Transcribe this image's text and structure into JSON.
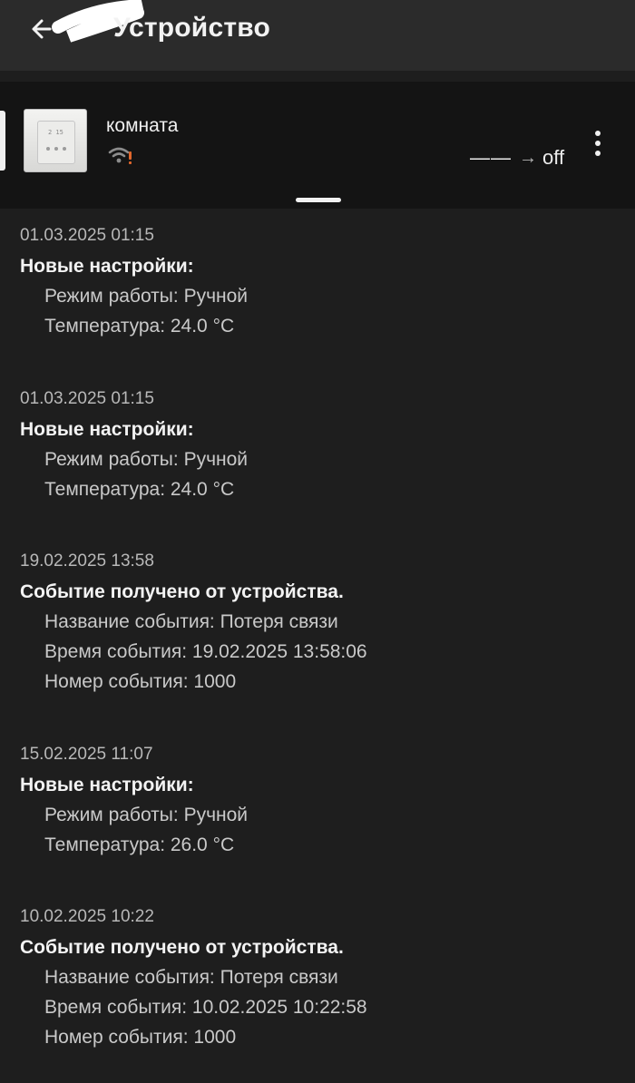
{
  "header": {
    "title": "Устройство"
  },
  "device": {
    "name": "комната",
    "status_dashes": "——",
    "status_arrow": "→",
    "status_value": "off",
    "wifi_icon": "wifi-warning-icon",
    "thumbnail_display": "2 15"
  },
  "events": [
    {
      "timestamp": "01.03.2025 01:15",
      "heading": "Новые настройки:",
      "details": [
        "Режим работы: Ручной",
        "Температура: 24.0 °C"
      ]
    },
    {
      "timestamp": "01.03.2025 01:15",
      "heading": "Новые настройки:",
      "details": [
        "Режим работы: Ручной",
        "Температура: 24.0 °C"
      ]
    },
    {
      "timestamp": "19.02.2025 13:58",
      "heading": "Событие получено от устройства.",
      "details": [
        "Название события: Потеря связи",
        "Время события: 19.02.2025 13:58:06",
        "Номер события: 1000"
      ]
    },
    {
      "timestamp": "15.02.2025 11:07",
      "heading": "Новые настройки:",
      "details": [
        "Режим работы: Ручной",
        "Температура: 26.0 °C"
      ]
    },
    {
      "timestamp": "10.02.2025 10:22",
      "heading": "Событие получено от устройства.",
      "details": [
        "Название события: Потеря связи",
        "Время события: 10.02.2025 10:22:58",
        "Номер события: 1000"
      ]
    }
  ],
  "colors": {
    "background": "#1e1e1e",
    "topbar": "#2b2b2b",
    "card": "#141414",
    "warning": "#e0662c"
  }
}
